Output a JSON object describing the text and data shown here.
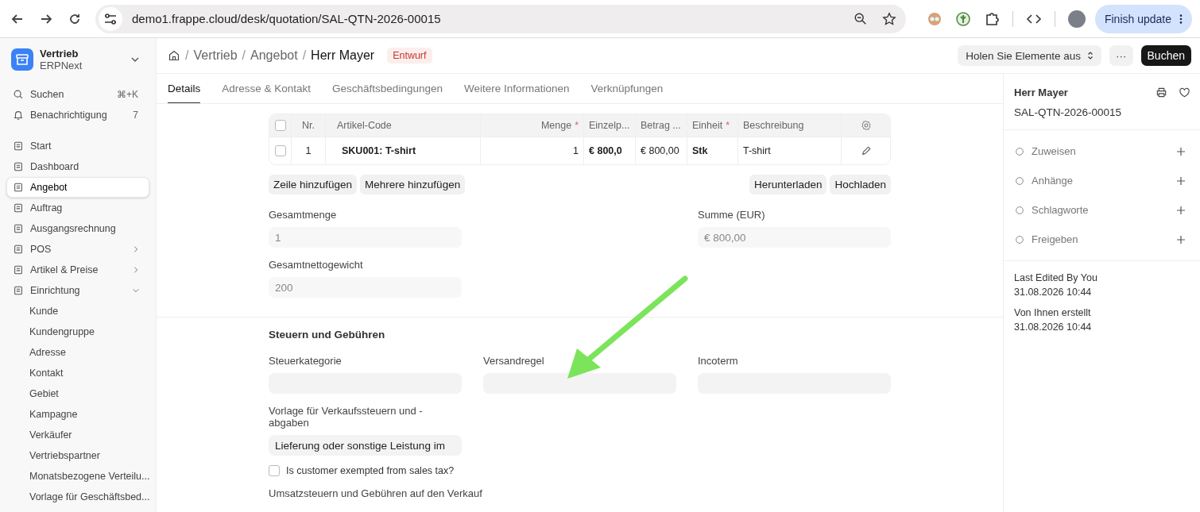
{
  "browser": {
    "url": "demo1.frappe.cloud/desk/quotation/SAL-QTN-2026-00015",
    "update_button": "Finish update"
  },
  "workspace": {
    "title": "Vertrieb",
    "subtitle": "ERPNext"
  },
  "search": {
    "label": "Suchen",
    "shortcut": "⌘+K"
  },
  "notifications": {
    "label": "Benachrichtigung",
    "count": "7"
  },
  "sidebar": {
    "items": [
      {
        "label": "Start",
        "selected": false
      },
      {
        "label": "Dashboard",
        "selected": false
      },
      {
        "label": "Angebot",
        "selected": true
      },
      {
        "label": "Auftrag",
        "selected": false
      },
      {
        "label": "Ausgangsrechnung",
        "selected": false
      },
      {
        "label": "POS",
        "selected": false,
        "expanded": false
      },
      {
        "label": "Artikel & Preise",
        "selected": false,
        "expanded": false
      },
      {
        "label": "Einrichtung",
        "selected": false,
        "expanded": true,
        "children": [
          {
            "label": "Kunde",
            "selected": false
          },
          {
            "label": "Kundengruppe",
            "selected": false
          },
          {
            "label": "Adresse",
            "selected": false
          },
          {
            "label": "Kontakt",
            "selected": false
          },
          {
            "label": "Gebiet",
            "selected": false
          },
          {
            "label": "Kampagne",
            "selected": false
          },
          {
            "label": "Verkäufer",
            "selected": false
          },
          {
            "label": "Vertriebspartner",
            "selected": false
          },
          {
            "label": "Monatsbezogene Verteilu...",
            "selected": false
          },
          {
            "label": "Vorlage für Geschäftsbed...",
            "selected": false
          }
        ]
      }
    ]
  },
  "breadcrumbs": [
    {
      "separator": "/",
      "label": "Vertrieb"
    },
    {
      "separator": "/",
      "label": "Angebot"
    },
    {
      "separator": "/",
      "label": "Herr Mayer"
    }
  ],
  "status_badge": "Entwurf",
  "actions": {
    "get_items": "Holen Sie Elemente aus",
    "more": "···",
    "submit": "Buchen"
  },
  "tabs": [
    {
      "label": "Details",
      "selected": true
    },
    {
      "label": "Adresse & Kontakt",
      "selected": false
    },
    {
      "label": "Geschäftsbedingungen",
      "selected": false
    },
    {
      "label": "Weitere Informationen",
      "selected": false
    },
    {
      "label": "Verknüpfungen",
      "selected": false
    }
  ],
  "items_table": {
    "all_checked": false,
    "columns": [
      {
        "label": "Nr."
      },
      {
        "label": "Artikel-Code"
      },
      {
        "label": "Menge",
        "required_mark": "*"
      },
      {
        "label": "Einzelp..."
      },
      {
        "label": "Betrag ..."
      },
      {
        "label": "Einheit",
        "required_mark": "*"
      },
      {
        "label": "Beschreibung"
      }
    ],
    "rows": [
      {
        "checked": false,
        "cells": [
          "1",
          "SKU001: T-shirt",
          "1",
          "€ 800,0",
          "€ 800,00",
          "Stk",
          "T-shirt"
        ]
      }
    ],
    "buttons_left": [
      "Zeile hinzufügen",
      "Mehrere hinzufügen"
    ],
    "buttons_right": [
      "Herunterladen",
      "Hochladen"
    ]
  },
  "totals": {
    "quantity": {
      "label": "Gesamtmenge",
      "value": "1"
    },
    "sum": {
      "label": "Summe (EUR)",
      "value": "€ 800,00"
    },
    "net_weight": {
      "label": "Gesamtnettogewicht",
      "value": "200"
    }
  },
  "taxes": {
    "title": "Steuern und Gebühren",
    "fields": [
      {
        "label": "Steuerkategorie"
      },
      {
        "label": "Versandregel"
      },
      {
        "label": "Incoterm"
      }
    ],
    "template": {
      "label": "Vorlage für Verkaufssteuern und -abgaben",
      "value": "Lieferung oder sonstige Leistung im"
    },
    "exempt": {
      "label": "Is customer exempted from sales tax?",
      "checked": false
    },
    "next_heading": "Umsatzsteuern und Gebühren auf den Verkauf"
  },
  "side_panel": {
    "title": "Herr Mayer",
    "id": "SAL-QTN-2026-00015",
    "actions": [
      "Zuweisen",
      "Anhänge",
      "Schlagworte",
      "Freigeben"
    ],
    "meta": [
      {
        "label": "Last Edited By You",
        "time": "31.08.2026 10:44"
      },
      {
        "label": "Von Ihnen erstellt",
        "time": "31.08.2026 10:44"
      }
    ]
  }
}
